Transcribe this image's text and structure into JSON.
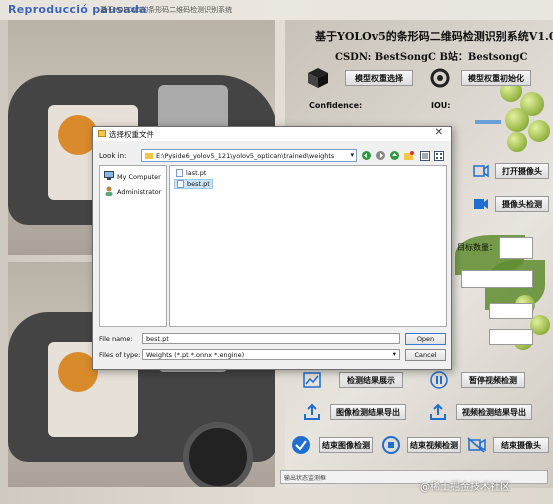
{
  "window": {
    "title_overlay": "Reproducció pausada",
    "title_small": "基于YOLOv5的条形码二维码检测识别系统"
  },
  "panel": {
    "title": "基于YOLOv5的条形码二维码检测识别系统V1.0",
    "csdn": "CSDN:   BestSongC   B站：BestsongC",
    "btn_select_weights": "模型权重选择",
    "btn_init_model": "模型权重初始化",
    "confidence_label": "Confidence:",
    "iou_label": "IOU:",
    "btn_open_camera": "打开摄像头",
    "btn_camera_detect": "摄像头检测",
    "target_count_label": "目标数量：",
    "btn_show_results": "检测结果展示",
    "btn_pause_video": "暂停视频检测",
    "btn_export_image": "图像检测结果导出",
    "btn_export_video": "视频检测结果导出",
    "btn_end_image": "结束图像检测",
    "btn_end_video": "结束视频检测",
    "btn_end_camera": "结束摄像头",
    "status_text": "输出状态监测框"
  },
  "watermark": "@稀土掘金技术社区",
  "dialog": {
    "title": "选择权重文件",
    "look_in_label": "Look in:",
    "look_in_path": "E:\\Pyside6_yolov5_121\\yolov5_optican\\trained\\weights",
    "sidebar": [
      {
        "label": "My Computer",
        "icon": "computer-icon"
      },
      {
        "label": "Administrator",
        "icon": "user-icon"
      }
    ],
    "files": [
      {
        "name": "last.pt",
        "selected": false
      },
      {
        "name": "best.pt",
        "selected": true
      }
    ],
    "file_name_label": "File name:",
    "file_name_value": "best.pt",
    "file_type_label": "Files of type:",
    "file_type_value": "Weights (*.pt *.onnx *.engine)",
    "open_label": "Open",
    "cancel_label": "Cancel"
  },
  "colors": {
    "accent": "#1f6fd1",
    "title_overlay": "#3b63b8",
    "selection": "#cce4f7"
  }
}
